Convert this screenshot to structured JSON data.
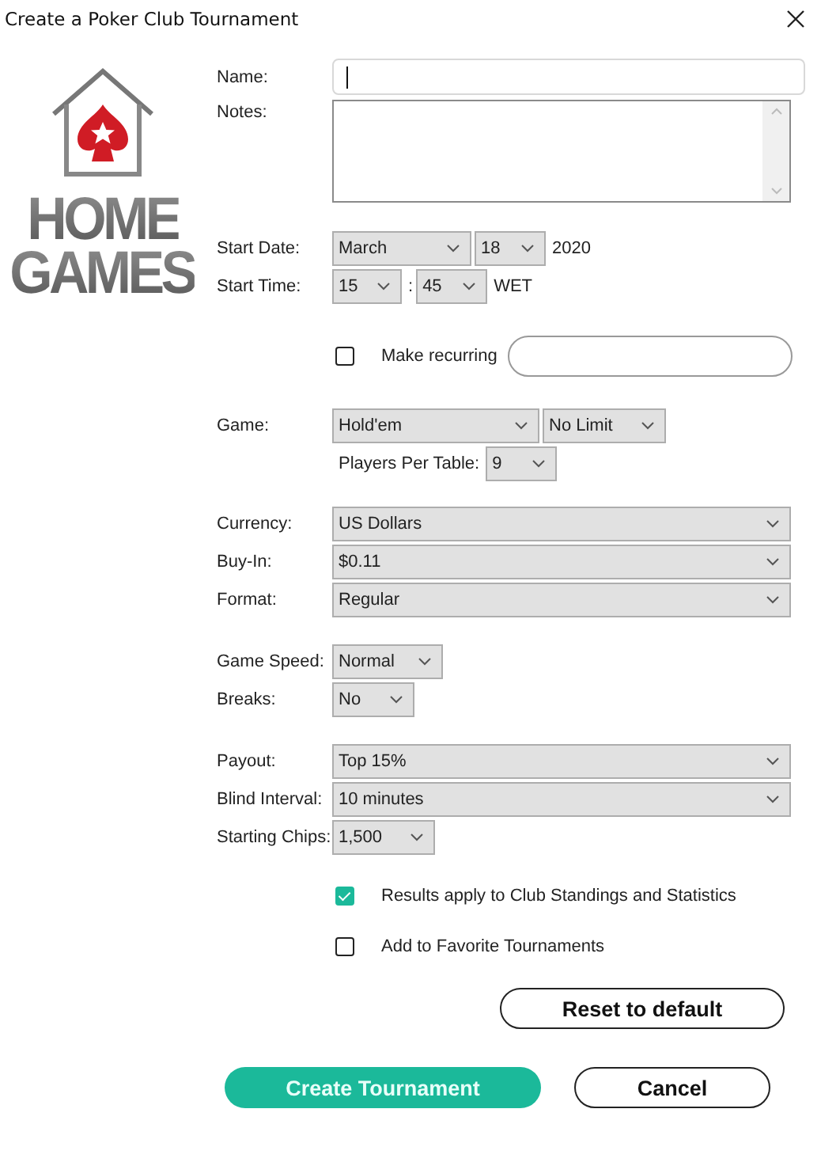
{
  "window": {
    "title": "Create a Poker Club Tournament"
  },
  "logo": {
    "line1": "HOME",
    "line2": "GAMES"
  },
  "name_field": {
    "label": "Name:"
  },
  "notes_field": {
    "label": "Notes:"
  },
  "start_date": {
    "label": "Start Date:",
    "month": "March",
    "day": "18",
    "year": "2020"
  },
  "start_time": {
    "label": "Start Time:",
    "hour": "15",
    "separator": ":",
    "minute": "45",
    "zone": "WET"
  },
  "recurring": {
    "label": "Make recurring",
    "checked": false
  },
  "game": {
    "label": "Game:",
    "type": "Hold'em",
    "limit": "No Limit",
    "players_label": "Players Per Table:",
    "players": "9"
  },
  "currency": {
    "label": "Currency:",
    "value": "US Dollars"
  },
  "buy_in": {
    "label": "Buy-In:",
    "value": "$0.11"
  },
  "format": {
    "label": "Format:",
    "value": "Regular"
  },
  "game_speed": {
    "label": "Game Speed:",
    "value": "Normal"
  },
  "breaks": {
    "label": "Breaks:",
    "value": "No"
  },
  "payout": {
    "label": "Payout:",
    "value": "Top 15%"
  },
  "blind_interval": {
    "label": "Blind Interval:",
    "value": "10 minutes"
  },
  "starting_chips": {
    "label": "Starting Chips:",
    "value": "1,500"
  },
  "options": [
    {
      "label": "Results apply to Club Standings and Statistics",
      "checked": true
    },
    {
      "label": "Add to Favorite Tournaments",
      "checked": false
    }
  ],
  "buttons": {
    "reset": "Reset to default",
    "create": "Create Tournament",
    "cancel": "Cancel"
  }
}
